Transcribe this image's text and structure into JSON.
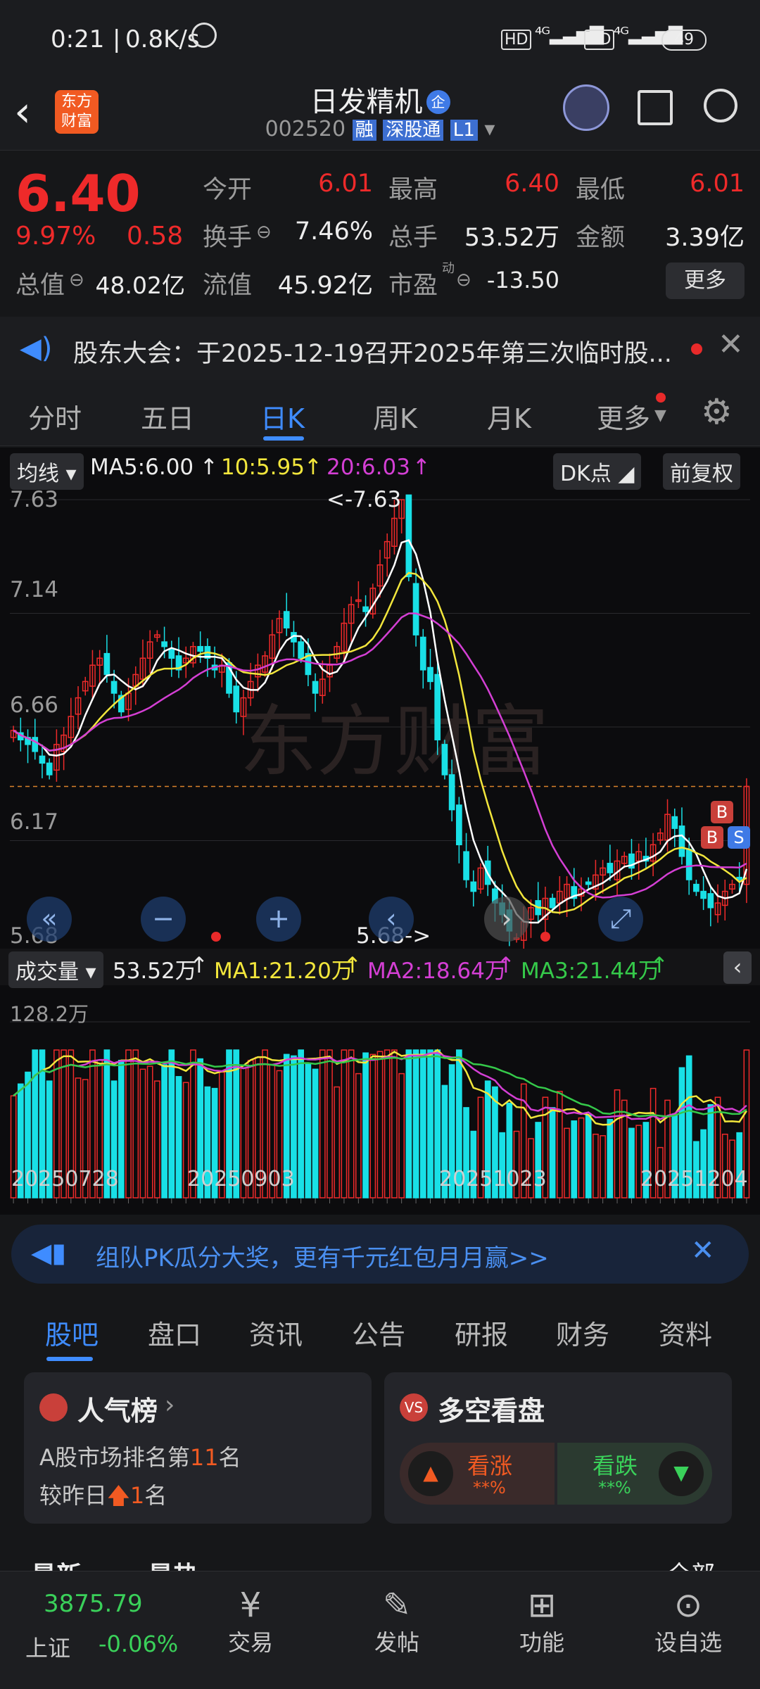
{
  "status_bar": {
    "time": "0:21",
    "speed": "0.8K/s",
    "battery": "49"
  },
  "header": {
    "name": "日发精机",
    "code": "002520",
    "tags": [
      "融",
      "深股通",
      "L1"
    ],
    "logo_line1": "东方",
    "logo_line2": "财富",
    "badge": "企"
  },
  "quote": {
    "price": "6.40",
    "change_pct": "9.97%",
    "change": "0.58",
    "open_label": "今开",
    "open": "6.01",
    "high_label": "最高",
    "high": "6.40",
    "low_label": "最低",
    "low": "6.01",
    "turnover_label": "换手",
    "turnover": "7.46%",
    "volume_label": "总手",
    "volume": "53.52万",
    "amount_label": "金额",
    "amount": "3.39亿",
    "mktcap_label": "总值",
    "mktcap": "48.02亿",
    "float_label": "流值",
    "float": "45.92亿",
    "pe_label": "市盈",
    "pe_sup": "动",
    "pe": "-13.50",
    "more_label": "更多"
  },
  "notice": {
    "text": "股东大会：于2025-12-19召开2025年第三次临时股..."
  },
  "tabs": [
    {
      "label": "分时"
    },
    {
      "label": "五日"
    },
    {
      "label": "日K"
    },
    {
      "label": "周K"
    },
    {
      "label": "月K"
    },
    {
      "label": "更多"
    }
  ],
  "chart_header": {
    "ma_btn": "均线",
    "ma5": "MA5:6.00",
    "ma10": "10:5.95",
    "ma20": "20:6.03",
    "dk": "DK点",
    "fq": "前复权",
    "watermark": "东方财富"
  },
  "price_axis": {
    "top": "7.63",
    "t2": "7.14",
    "t3": "6.66",
    "t4": "6.17",
    "bottom": "5.68"
  },
  "annotations": {
    "high": "<-7.63",
    "low": "5.68->",
    "b1": "B",
    "b2": "B",
    "s1": "S"
  },
  "volume_header": {
    "btn": "成交量",
    "vol": "53.52万",
    "ma1": "MA1:21.20万",
    "ma2": "MA2:18.64万",
    "ma3": "MA3:21.44万",
    "scale": "128.2万"
  },
  "dates": [
    "20250728",
    "20250903",
    "20251023",
    "20251204"
  ],
  "colors": {
    "up": "#ee2a2a",
    "down": "#19e0e6",
    "ma5": "#ffffff",
    "ma10": "#f2e63c",
    "ma20": "#d43fd4",
    "vma3": "#35c94a",
    "accent": "#3f8cff"
  },
  "chart_data": {
    "type": "candlestick",
    "ylim": [
      5.68,
      7.63
    ],
    "closes": [
      6.64,
      6.6,
      6.58,
      6.55,
      6.5,
      6.45,
      6.58,
      6.62,
      6.7,
      6.78,
      6.85,
      6.92,
      6.95,
      6.88,
      6.8,
      6.72,
      6.8,
      6.88,
      6.95,
      7.02,
      7.05,
      7.0,
      6.95,
      6.9,
      6.95,
      7.0,
      6.98,
      6.95,
      6.9,
      6.92,
      6.8,
      6.72,
      6.78,
      6.85,
      6.92,
      6.96,
      7.05,
      7.12,
      7.08,
      7.02,
      6.95,
      6.88,
      6.8,
      6.86,
      6.92,
      7.0,
      7.1,
      7.18,
      7.2,
      7.15,
      7.25,
      7.35,
      7.45,
      7.55,
      7.63,
      7.3,
      7.05,
      6.9,
      6.85,
      6.6,
      6.45,
      6.3,
      6.15,
      6.0,
      5.95,
      6.05,
      5.98,
      5.9,
      5.85,
      5.78,
      5.75,
      5.82,
      5.88,
      5.85,
      5.92,
      5.88,
      5.95,
      5.98,
      5.92,
      5.96,
      5.98,
      6.02,
      6.05,
      6.03,
      6.08,
      6.1,
      6.05,
      6.12,
      6.08,
      6.15,
      6.2,
      6.28,
      6.22,
      6.1,
      6.0,
      5.95,
      5.92,
      5.88,
      5.9,
      5.95,
      5.98,
      6.0,
      6.4
    ],
    "volume_scale_max": "128.2万"
  },
  "ad": {
    "text": "组队PK瓜分大奖，更有千元红包月月赢>>"
  },
  "subtabs": [
    {
      "label": "股吧"
    },
    {
      "label": "盘口"
    },
    {
      "label": "资讯"
    },
    {
      "label": "公告"
    },
    {
      "label": "研报"
    },
    {
      "label": "财务"
    },
    {
      "label": "资料"
    }
  ],
  "popularity": {
    "title": "人气榜",
    "line1_pre": "A股市场排名第",
    "rank": "11",
    "line1_post": "名",
    "line2_pre": "较昨日",
    "change": "1",
    "line2_post": "名"
  },
  "sentiment": {
    "title": "多空看盘",
    "bull": "看涨",
    "bull_pct": "**%",
    "bear": "看跌",
    "bear_pct": "**%"
  },
  "feed": {
    "latest": "最新",
    "hot": "最热",
    "all": "全部"
  },
  "bottom": {
    "index_val": "3875.79",
    "index_name": "上证",
    "index_chg": "-0.06%",
    "items": [
      {
        "label": "交易"
      },
      {
        "label": "发帖"
      },
      {
        "label": "功能"
      },
      {
        "label": "设自选"
      }
    ]
  }
}
